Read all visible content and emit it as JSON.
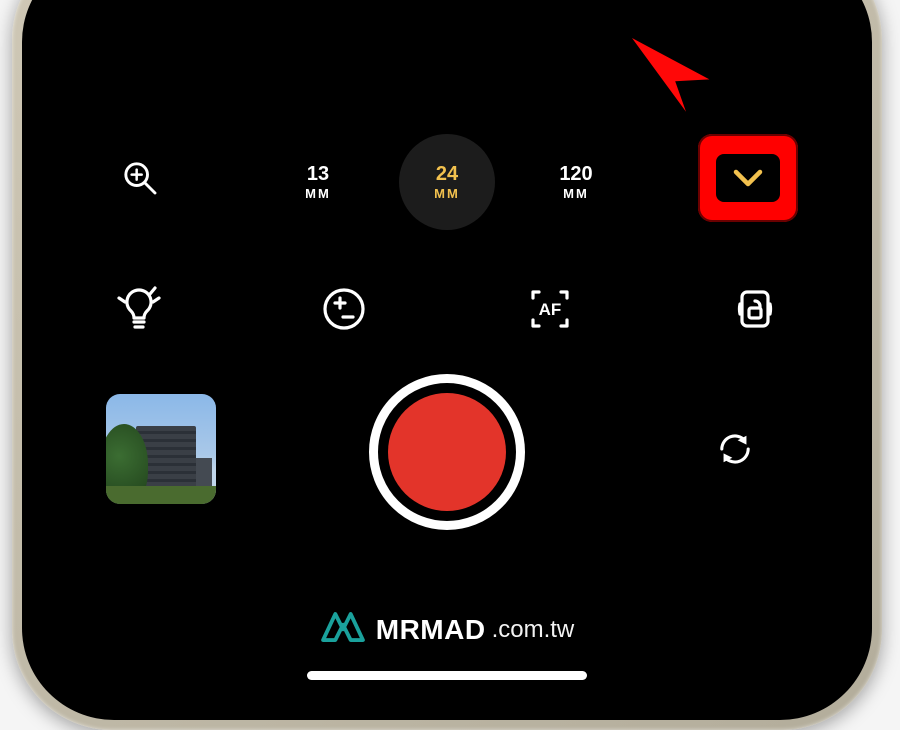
{
  "lenses": [
    {
      "value": "13",
      "unit": "MM",
      "active": false
    },
    {
      "value": "24",
      "unit": "MM",
      "active": true
    },
    {
      "value": "120",
      "unit": "MM",
      "active": false
    }
  ],
  "icons": {
    "zoom": "zoom-in-icon",
    "expand_menu": "chevron-down-icon",
    "light": "lightbulb-icon",
    "exposure": "exposure-plus-minus-icon",
    "autofocus": "autofocus-icon",
    "lock": "rotation-lock-icon",
    "flip": "camera-flip-icon",
    "shutter": "shutter-icon",
    "gallery": "gallery-thumbnail"
  },
  "autofocus_label": "AF",
  "watermark": {
    "brand": "MRMAD",
    "suffix": ".com.tw"
  },
  "colors": {
    "accent": "#f2c14e",
    "shutter": "#e3342a",
    "highlight_box": "#ff0000",
    "logo_teal": "#1aa19c"
  },
  "annotation": {
    "arrow": "callout-arrow",
    "target": "expand-controls-button"
  }
}
